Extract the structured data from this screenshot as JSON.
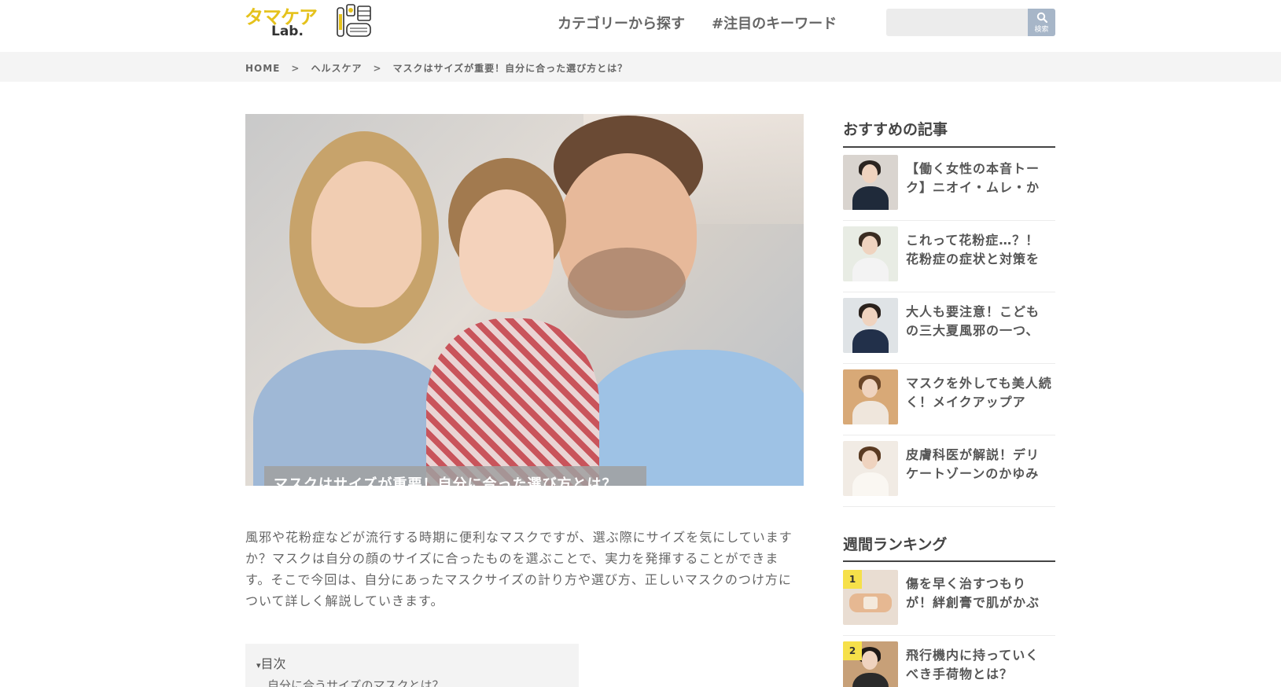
{
  "header": {
    "logo_top": "タマケア",
    "logo_bottom": "Lab.",
    "nav": [
      "カテゴリーから探す",
      "#注目のキーワード"
    ],
    "search_placeholder": "",
    "search_button_label": "検索"
  },
  "breadcrumb": {
    "items": [
      "HOME",
      "ヘルスケア",
      "マスクはサイズが重要！自分に合った選び方とは？"
    ],
    "separator": ">"
  },
  "article": {
    "title": "マスクはサイズが重要！自分に合った選び方とは？",
    "intro": "風邪や花粉症などが流行する時期に便利なマスクですが、選ぶ際にサイズを気にしていますか？マスクは自分の顔のサイズに合ったものを選ぶことで、実力を発揮することができます。そこで今回は、自分にあったマスクサイズの計り方や選び方、正しいマスクのつけ方について詳しく解説していきます。",
    "toc_title": "目次",
    "toc_first": "自分に合うサイズのマスクとは？"
  },
  "sidebar": {
    "recommended_title": "おすすめの記事",
    "recommended": [
      {
        "title": "【働く女性の本音トーク】ニオイ・ムレ・か"
      },
      {
        "title": "これって花粉症…？！花粉症の症状と対策を"
      },
      {
        "title": "大人も要注意！こどもの三大夏風邪の一つ、"
      },
      {
        "title": "マスクを外しても美人続く！メイクアップア"
      },
      {
        "title": "皮膚科医が解説！デリケートゾーンのかゆみ"
      }
    ],
    "ranking_title": "週間ランキング",
    "ranking": [
      {
        "rank": "1",
        "title": "傷を早く治すつもりが！絆創膏で肌がかぶ"
      },
      {
        "rank": "2",
        "title": "飛行機内に持っていくべき手荷物とは？"
      }
    ]
  },
  "colors": {
    "logo_yellow": "#e5c21c",
    "search_button": "#a7b6c8",
    "rank_badge": "#f6e04a"
  }
}
